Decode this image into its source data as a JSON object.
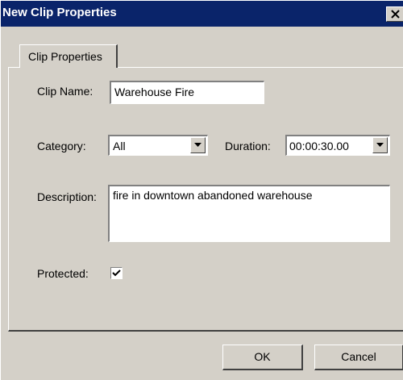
{
  "window": {
    "title": "New Clip Properties"
  },
  "tabs": [
    {
      "label": "Clip Properties",
      "active": true
    }
  ],
  "form": {
    "clip_name_label": "Clip Name:",
    "clip_name_value": "Warehouse Fire",
    "category_label": "Category:",
    "category_value": "All",
    "duration_label": "Duration:",
    "duration_value": "00:00:30.00",
    "description_label": "Description:",
    "description_value": "fire in downtown abandoned warehouse",
    "protected_label": "Protected:",
    "protected_checked": true
  },
  "buttons": {
    "ok_label": "OK",
    "cancel_label": "Cancel"
  },
  "icons": {
    "close": "close-icon",
    "dropdown": "chevron-down-icon",
    "check": "checkmark-icon"
  },
  "colors": {
    "titlebar": "#0a246a",
    "face": "#d4d0c8",
    "field": "#ffffff"
  }
}
